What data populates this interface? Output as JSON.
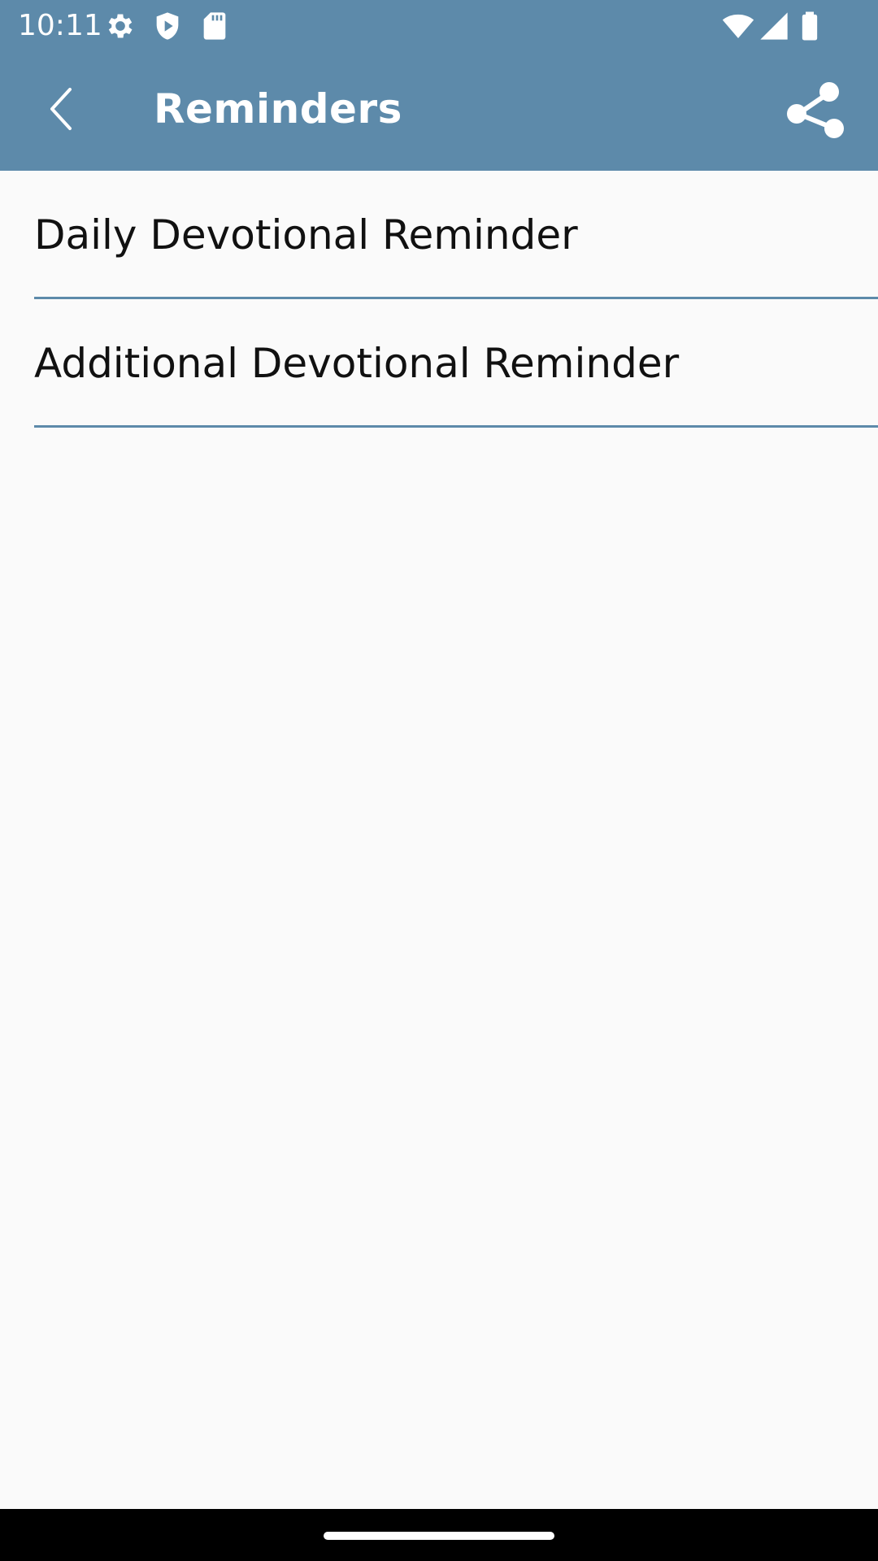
{
  "status_bar": {
    "time": "10:11",
    "left_icons": [
      "gear-icon",
      "shield-play-icon",
      "sd-card-icon"
    ],
    "right_icons": [
      "wifi-icon",
      "cell-signal-icon",
      "battery-icon"
    ]
  },
  "app_bar": {
    "title": "Reminders",
    "back_icon": "chevron-left-icon",
    "share_icon": "share-icon"
  },
  "reminders": {
    "items": [
      {
        "label": "Daily Devotional Reminder"
      },
      {
        "label": "Additional Devotional Reminder"
      }
    ]
  },
  "colors": {
    "accent": "#5d8aaa",
    "background": "#fafafa",
    "text": "#111111",
    "nav_bar": "#000000"
  }
}
